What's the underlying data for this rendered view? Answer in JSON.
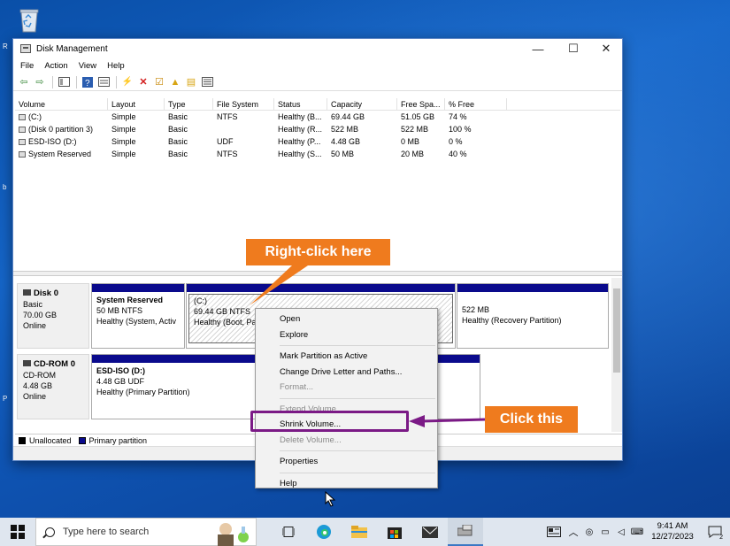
{
  "window": {
    "title": "Disk Management",
    "minimize": "—",
    "maximize": "☐",
    "close": "✕"
  },
  "menu": [
    "File",
    "Action",
    "View",
    "Help"
  ],
  "volume_table": {
    "columns": [
      "Volume",
      "Layout",
      "Type",
      "File System",
      "Status",
      "Capacity",
      "Free Spa...",
      "% Free"
    ],
    "rows": [
      [
        "(C:)",
        "Simple",
        "Basic",
        "NTFS",
        "Healthy (B...",
        "69.44 GB",
        "51.05 GB",
        "74 %"
      ],
      [
        "(Disk 0 partition 3)",
        "Simple",
        "Basic",
        "",
        "Healthy (R...",
        "522 MB",
        "522 MB",
        "100 %"
      ],
      [
        "ESD-ISO (D:)",
        "Simple",
        "Basic",
        "UDF",
        "Healthy (P...",
        "4.48 GB",
        "0 MB",
        "0 %"
      ],
      [
        "System Reserved",
        "Simple",
        "Basic",
        "NTFS",
        "Healthy (S...",
        "50 MB",
        "20 MB",
        "40 %"
      ]
    ]
  },
  "disks": [
    {
      "name": "Disk 0",
      "type": "Basic",
      "size": "70.00 GB",
      "state": "Online",
      "partitions": [
        {
          "name": "System Reserved",
          "size": "50 MB NTFS",
          "status": "Healthy (System, Activ"
        },
        {
          "name": "(C:)",
          "size": "69.44 GB NTFS",
          "status": "Healthy (Boot, Pa"
        },
        {
          "name": "",
          "size": "522 MB",
          "status": "Healthy (Recovery Partition)"
        }
      ]
    },
    {
      "name": "CD-ROM 0",
      "type": "CD-ROM",
      "size": "4.48 GB",
      "state": "Online",
      "partitions": [
        {
          "name": "ESD-ISO  (D:)",
          "size": "4.48 GB UDF",
          "status": "Healthy (Primary Partition)"
        }
      ]
    }
  ],
  "legend": {
    "unallocated": "Unallocated",
    "primary": "Primary partition",
    "unallocated_color": "#000000",
    "primary_color": "#0a0a8c"
  },
  "context_menu": {
    "items": [
      {
        "label": "Open",
        "enabled": true
      },
      {
        "label": "Explore",
        "enabled": true
      },
      {
        "label": "Mark Partition as Active",
        "enabled": true
      },
      {
        "label": "Change Drive Letter and Paths...",
        "enabled": true
      },
      {
        "label": "Format...",
        "enabled": false
      },
      {
        "label": "Extend Volume...",
        "enabled": false
      },
      {
        "label": "Shrink Volume...",
        "enabled": true
      },
      {
        "label": "Delete Volume...",
        "enabled": false
      },
      {
        "label": "Properties",
        "enabled": true
      },
      {
        "label": "Help",
        "enabled": true
      }
    ]
  },
  "callouts": {
    "right_click": "Right-click here",
    "click_this": "Click this",
    "callout_color": "#ef7b1e",
    "highlight_color": "#7b1a86"
  },
  "taskbar": {
    "search_placeholder": "Type here to search",
    "time": "9:41 AM",
    "date": "12/27/2023",
    "notification_count": "2"
  }
}
